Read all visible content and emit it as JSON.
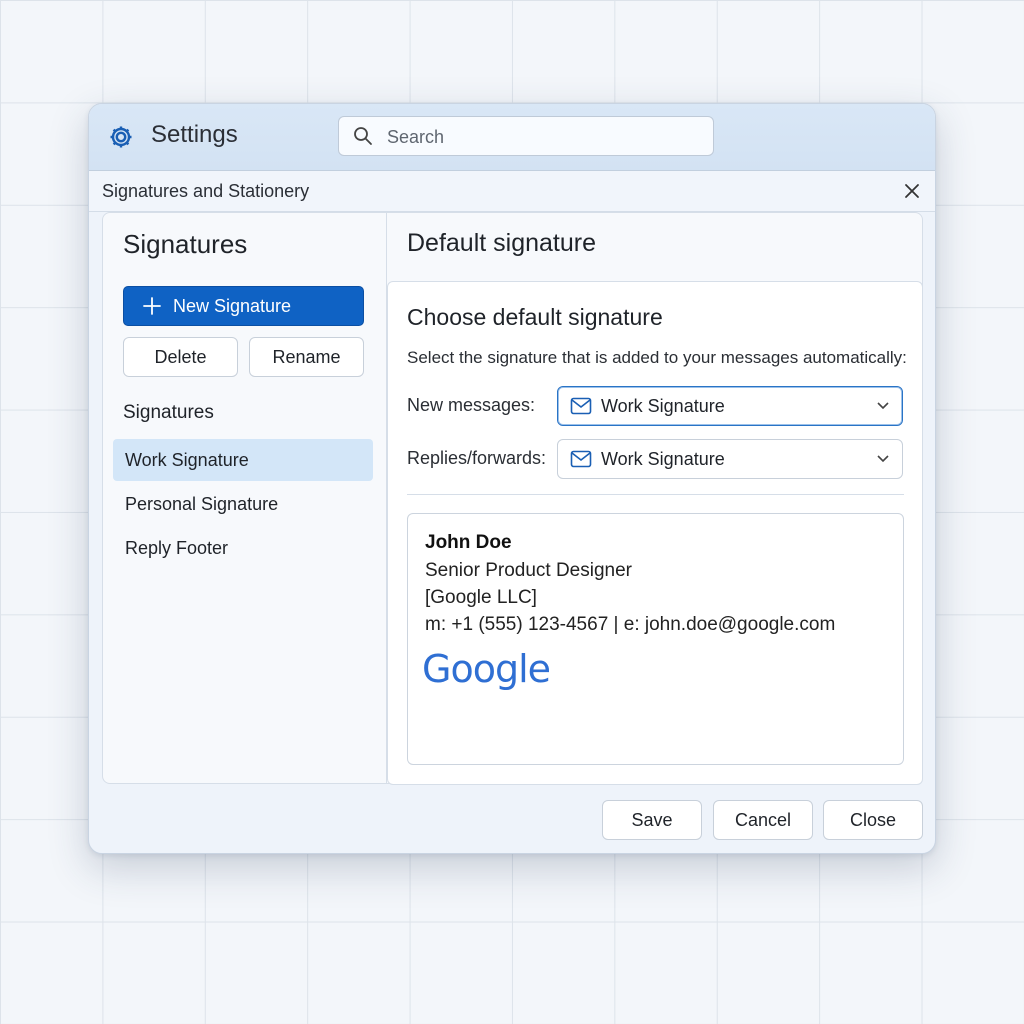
{
  "window": {
    "title": "Settings",
    "search": {
      "placeholder": "Search",
      "value": ""
    },
    "subtitle": "Signatures and Stationery"
  },
  "signatures_panel": {
    "heading": "Signatures",
    "new_button": "New Signature",
    "delete_button": "Delete",
    "rename_button": "Rename",
    "list_label": "Signatures",
    "items": [
      {
        "label": "Work Signature",
        "selected": true
      },
      {
        "label": "Personal Signature",
        "selected": false
      },
      {
        "label": "Reply Footer",
        "selected": false
      }
    ]
  },
  "default_panel": {
    "heading": "Default signature",
    "card_title": "Choose default signature",
    "description": "Select the signature that is added to your messages automatically:",
    "new_messages": {
      "label": "New messages:",
      "value": "Work Signature"
    },
    "replies": {
      "label": "Replies/forwards:",
      "value": "Work Signature"
    }
  },
  "preview": {
    "name": "John Doe",
    "title": "Senior Product Designer",
    "company": "[Google LLC]",
    "contact": "m: +1 (555) 123-4567 | e: john.doe@google.com",
    "logo_text": "Google"
  },
  "footer": {
    "save": "Save",
    "cancel": "Cancel",
    "close": "Close"
  },
  "colors": {
    "primary": "#0f62c4",
    "selected_row": "#d3e6f8",
    "logo": "#2f6fd3",
    "titlebar": "#d9e7f6"
  },
  "icons": [
    "gear-icon",
    "search-icon",
    "close-icon",
    "plus-icon",
    "mail-icon",
    "chevron-down-icon"
  ]
}
